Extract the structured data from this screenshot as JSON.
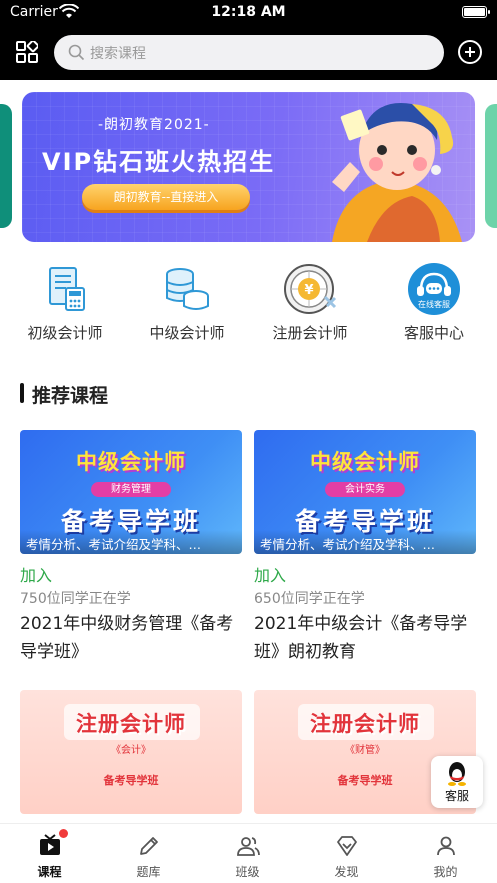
{
  "status_bar": {
    "carrier": "Carrier",
    "time": "12:18 AM"
  },
  "header": {
    "search_placeholder": "搜索课程"
  },
  "banner": {
    "subtitle": "-朗初教育2021-",
    "title": "VIP钻石班火热招生",
    "cta_label": "朗初教育--直接进入",
    "accent_color": "#6a63f3"
  },
  "categories": [
    {
      "label": "初级会计师",
      "icon": "calculator-document-icon"
    },
    {
      "label": "中级会计师",
      "icon": "coins-stack-icon"
    },
    {
      "label": "注册会计师",
      "icon": "yen-globe-icon"
    },
    {
      "label": "客服中心",
      "icon": "headset-service-icon",
      "badge": "在线客服"
    }
  ],
  "section": {
    "title": "推荐课程"
  },
  "courses": [
    {
      "thumb_title": "中级会计师",
      "thumb_pill": "财务管理",
      "thumb_main": "备考导学班",
      "caption": "考情分析、考试介绍及学科、…",
      "join_label": "加入",
      "students": "750位同学正在学",
      "name": "2021年中级财务管理《备考导学班》"
    },
    {
      "thumb_title": "中级会计师",
      "thumb_pill": "会计实务",
      "thumb_main": "备考导学班",
      "caption": "考情分析、考试介绍及学科、…",
      "join_label": "加入",
      "students": "650位同学正在学",
      "name": "2021年中级会计《备考导学班》朗初教育"
    },
    {
      "thumb_title": "注册会计师",
      "thumb_pill": "《会计》",
      "thumb_main": "备考导学班"
    },
    {
      "thumb_title": "注册会计师",
      "thumb_pill": "《财管》",
      "thumb_main": "备考导学班"
    }
  ],
  "float_service": {
    "label": "客服"
  },
  "tabs": [
    {
      "label": "课程",
      "icon": "tv-play-icon",
      "active": true,
      "has_dot": true
    },
    {
      "label": "题库",
      "icon": "pencil-icon"
    },
    {
      "label": "班级",
      "icon": "users-icon"
    },
    {
      "label": "发现",
      "icon": "diamond-icon"
    },
    {
      "label": "我的",
      "icon": "person-icon"
    }
  ]
}
